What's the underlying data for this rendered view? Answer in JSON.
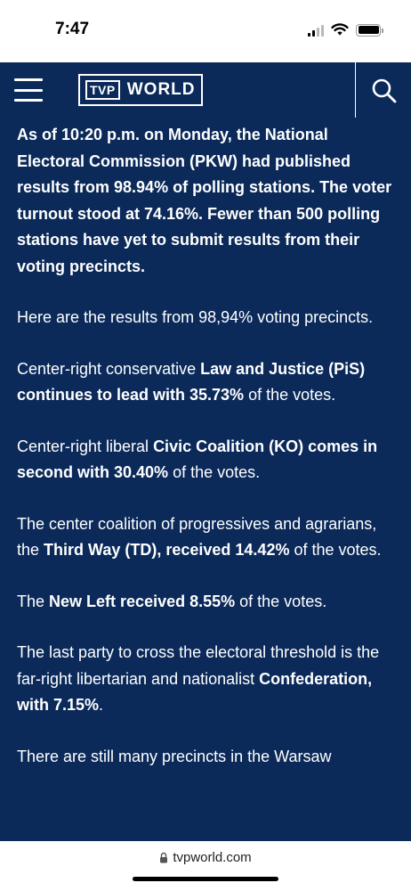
{
  "status_bar": {
    "time": "7:47"
  },
  "nav": {
    "logo_tvp": "TVP",
    "logo_world": "WORLD"
  },
  "article": {
    "lead": "As of 10:20 p.m. on Monday, the National Electoral Commission (PKW) had published results from 98.94% of polling stations. The voter turnout stood at 74.16%. Fewer than 500 polling stations have yet to submit results from their voting precincts.",
    "p1": "Here are the results from 98,94% voting precincts.",
    "p2_pre": "Center-right conservative ",
    "p2_bold": "Law and Justice (PiS) continues to lead with 35.73%",
    "p2_post": " of the votes.",
    "p3_pre": "Center-right liberal ",
    "p3_bold": "Civic Coalition (KO) comes in second with 30.40%",
    "p3_post": " of the votes.",
    "p4_pre": "The center coalition of progressives and agrarians, the ",
    "p4_bold": "Third Way (TD), received 14.42%",
    "p4_post": " of the votes.",
    "p5_pre": "The ",
    "p5_bold": "New Left received 8.55%",
    "p5_post": " of the votes.",
    "p6_pre": "The last party to cross the electoral threshold is the far-right libertarian and nationalist ",
    "p6_bold": "Confederation, with 7.15%",
    "p6_post": ".",
    "p7": "There are still many precincts in the Warsaw"
  },
  "browser": {
    "url": "tvpworld.com"
  },
  "colors": {
    "navy": "#0b2a5a",
    "white": "#ffffff"
  }
}
